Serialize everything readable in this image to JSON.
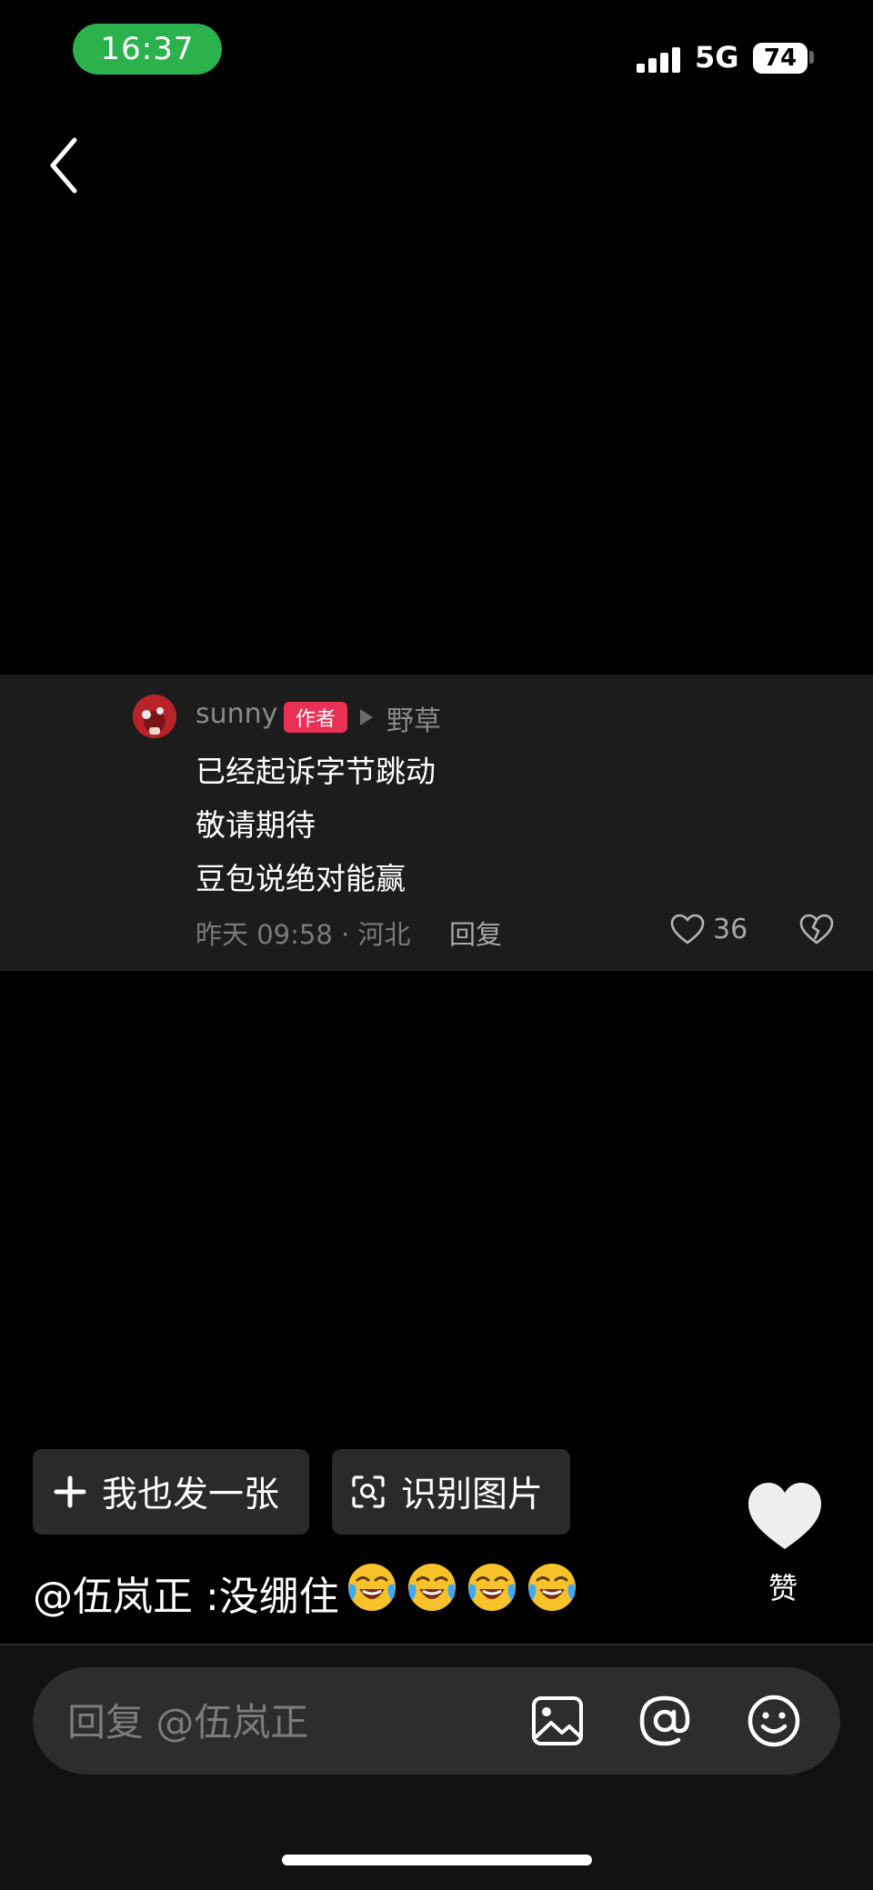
{
  "status_bar": {
    "time": "16:37",
    "network": "5G",
    "battery": "74",
    "accent_color": "#2bb24c"
  },
  "icons": {
    "back": "back-chevron-icon",
    "like": "heart-outline-icon",
    "dislike": "broken-heart-icon",
    "plus": "plus-icon",
    "scan": "scan-image-icon",
    "big_like": "heart-filled-icon",
    "image": "image-icon",
    "at": "at-icon",
    "emoji": "emoji-smile-icon"
  },
  "comment": {
    "username": "sunny",
    "author_badge": "作者",
    "reply_target": "野草",
    "lines": [
      "已经起诉字节跳动",
      "敬请期待",
      "豆包说绝对能赢"
    ],
    "time_location": "昨天 09:58 · 河北",
    "reply_label": "回复",
    "like_count": "36",
    "badge_color": "#e83155"
  },
  "actions": {
    "post_label": "我也发一张",
    "recognize_label": "识别图片",
    "like_label": "赞"
  },
  "caption": {
    "text": "@伍岚正 :没绷住",
    "emoji_count": 4,
    "emoji_name": "laugh-cry-emoji"
  },
  "reply_bar": {
    "placeholder": "回复 @伍岚正"
  }
}
